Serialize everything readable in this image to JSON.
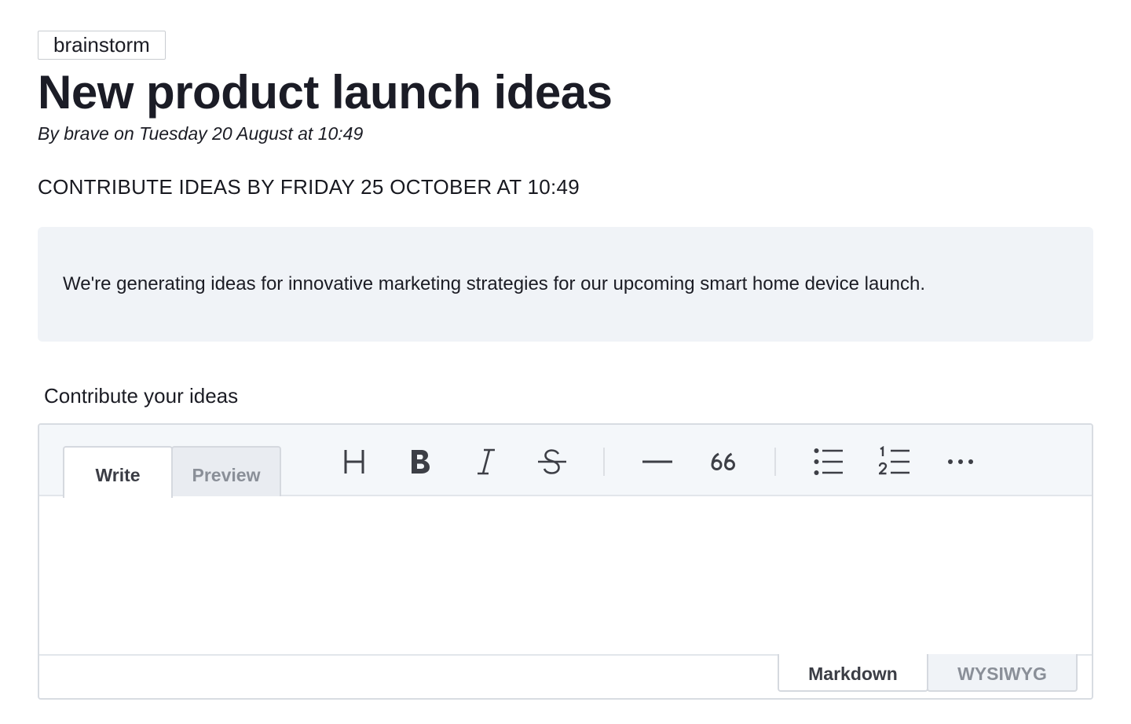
{
  "tag": "brainstorm",
  "title": "New product launch ideas",
  "byline": "By brave on Tuesday 20 August at 10:49",
  "deadline": "CONTRIBUTE IDEAS BY FRIDAY 25 OCTOBER AT 10:49",
  "description": "We're generating ideas for innovative marketing strategies for our upcoming smart home device launch.",
  "contribute_label": "Contribute your ideas",
  "editor": {
    "tabs": {
      "write": "Write",
      "preview": "Preview",
      "active": "Write"
    },
    "toolbar": [
      "heading-icon",
      "bold-icon",
      "italic-icon",
      "strikethrough-icon",
      "horizontal-rule-icon",
      "quote-icon",
      "bullet-list-icon",
      "numbered-list-icon",
      "more-icon"
    ],
    "value": "",
    "modes": {
      "markdown": "Markdown",
      "wysiwyg": "WYSIWYG",
      "active": "Markdown"
    }
  },
  "colors": {
    "description_bg": "#f0f3f7",
    "toolbar_bg": "#f4f7fa",
    "text": "#1b1c24",
    "muted": "#8a8f98"
  }
}
